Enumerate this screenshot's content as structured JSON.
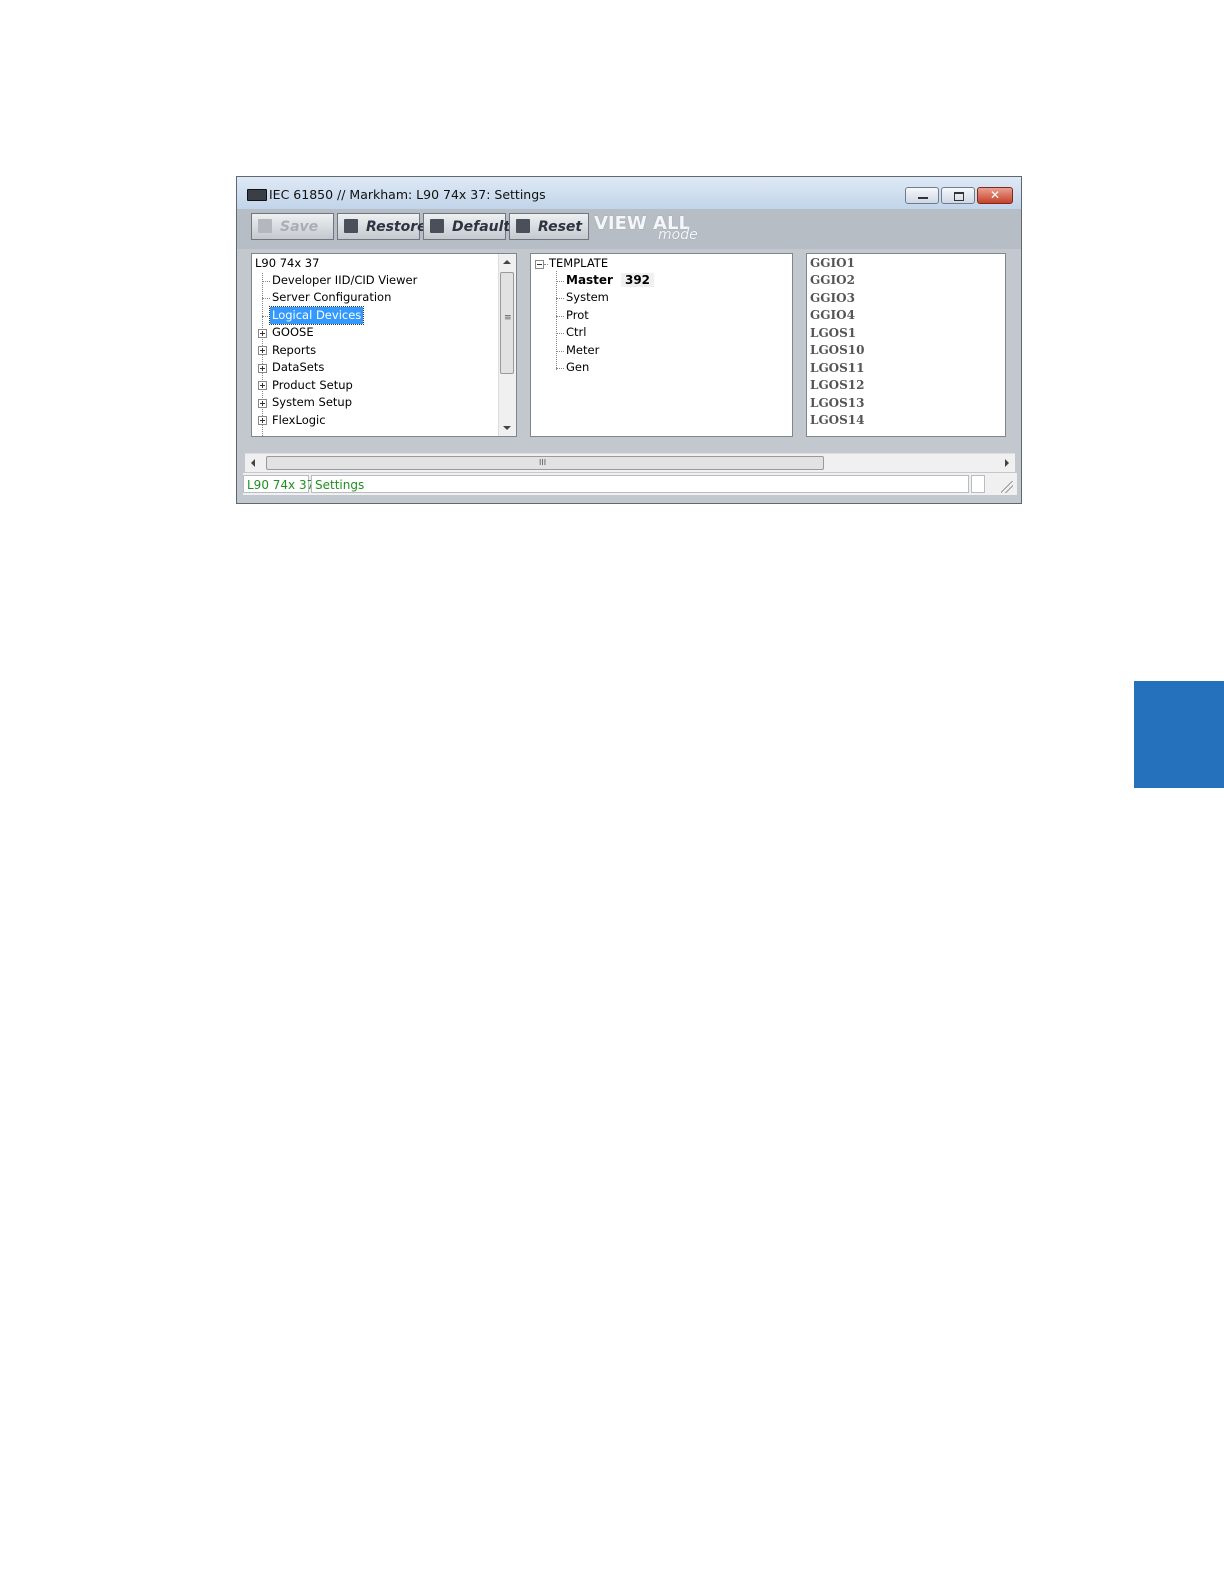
{
  "window": {
    "title": "IEC 61850 // Markham: L90 74x 37: Settings"
  },
  "toolbar": {
    "save_label": "Save",
    "restore_label": "Restore",
    "default_label": "Default",
    "reset_label": "Reset",
    "view_all_label": "VIEW ALL",
    "view_mode_label": "mode"
  },
  "left_tree": {
    "root": "L90 74x 37",
    "items": [
      {
        "label": "Developer IID/CID Viewer",
        "expandable": false
      },
      {
        "label": "Server Configuration",
        "expandable": false
      },
      {
        "label": "Logical Devices",
        "expandable": false,
        "selected": true
      },
      {
        "label": "GOOSE",
        "expandable": true
      },
      {
        "label": "Reports",
        "expandable": true
      },
      {
        "label": "DataSets",
        "expandable": true
      },
      {
        "label": "Product Setup",
        "expandable": true
      },
      {
        "label": "System Setup",
        "expandable": true
      },
      {
        "label": "FlexLogic",
        "expandable": true
      }
    ]
  },
  "middle_tree": {
    "root": "TEMPLATE",
    "items": [
      {
        "label": "Master",
        "count": "392"
      },
      {
        "label": "System"
      },
      {
        "label": "Prot"
      },
      {
        "label": "Ctrl"
      },
      {
        "label": "Meter"
      },
      {
        "label": "Gen"
      }
    ]
  },
  "right_list": {
    "items": [
      "GGIO1",
      "GGIO2",
      "GGIO3",
      "GGIO4",
      "LGOS1",
      "LGOS10",
      "LGOS11",
      "LGOS12",
      "LGOS13",
      "LGOS14"
    ]
  },
  "status": {
    "device": "L90 74x 37",
    "mode": "Settings"
  },
  "colors": {
    "side_tab": "#2571bb",
    "selection": "#3399ff",
    "status_text": "#1f8f1f"
  }
}
